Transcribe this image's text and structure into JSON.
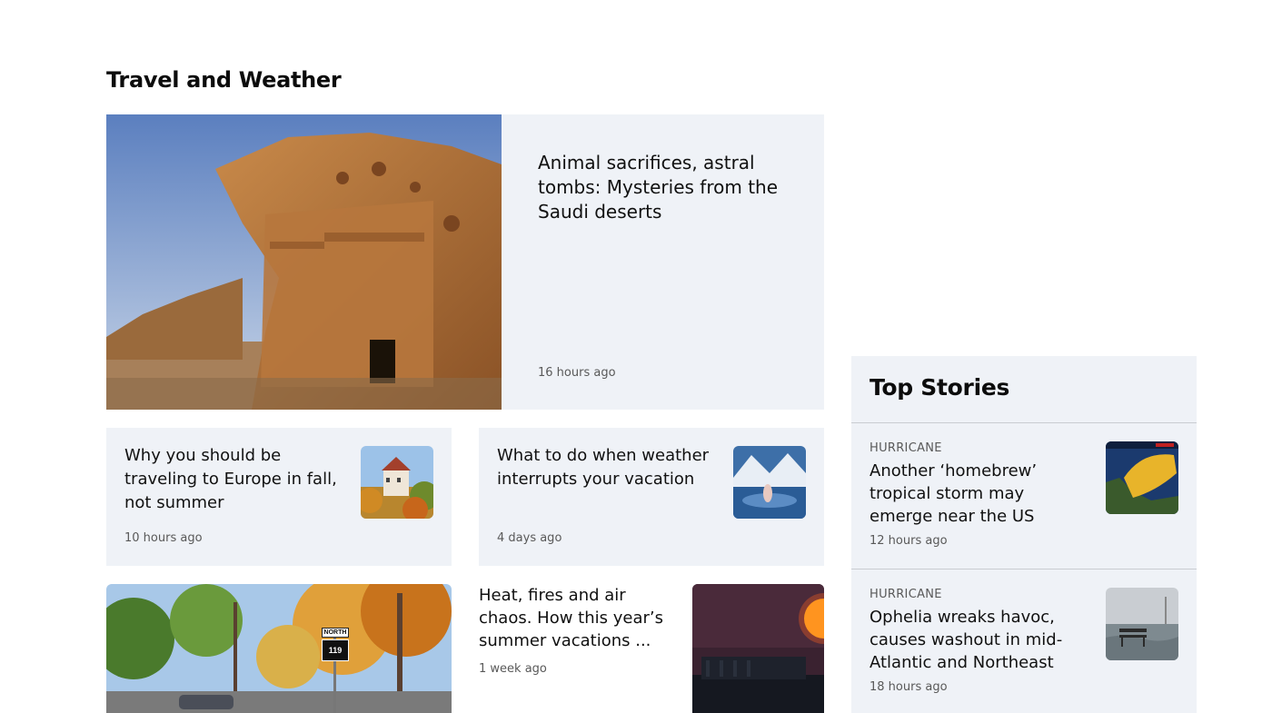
{
  "section": {
    "title": "Travel and Weather"
  },
  "hero": {
    "headline": "Animal sacrifices, astral tombs: Mysteries from the Saudi deserts",
    "time": "16 hours ago"
  },
  "cards": [
    {
      "headline": "Why you should be traveling to Europe in fall, not summer",
      "time": "10 hours ago"
    },
    {
      "headline": "What to do when weather interrupts your vacation",
      "time": "4 days ago"
    }
  ],
  "plain_story": {
    "headline": "Heat, fires and air chaos. How this year’s summer vacations ...",
    "time": "1 week ago"
  },
  "road_sign": {
    "top": "NORTH",
    "route": "119"
  },
  "top_stories": {
    "title": "Top Stories",
    "items": [
      {
        "kicker": "HURRICANE",
        "headline": "Another ‘homebrew’ tropical storm may emerge near the US",
        "time": "12 hours ago"
      },
      {
        "kicker": "HURRICANE",
        "headline": "Ophelia wreaks havoc, causes washout in mid-Atlantic and Northeast",
        "time": "18 hours ago"
      }
    ]
  }
}
